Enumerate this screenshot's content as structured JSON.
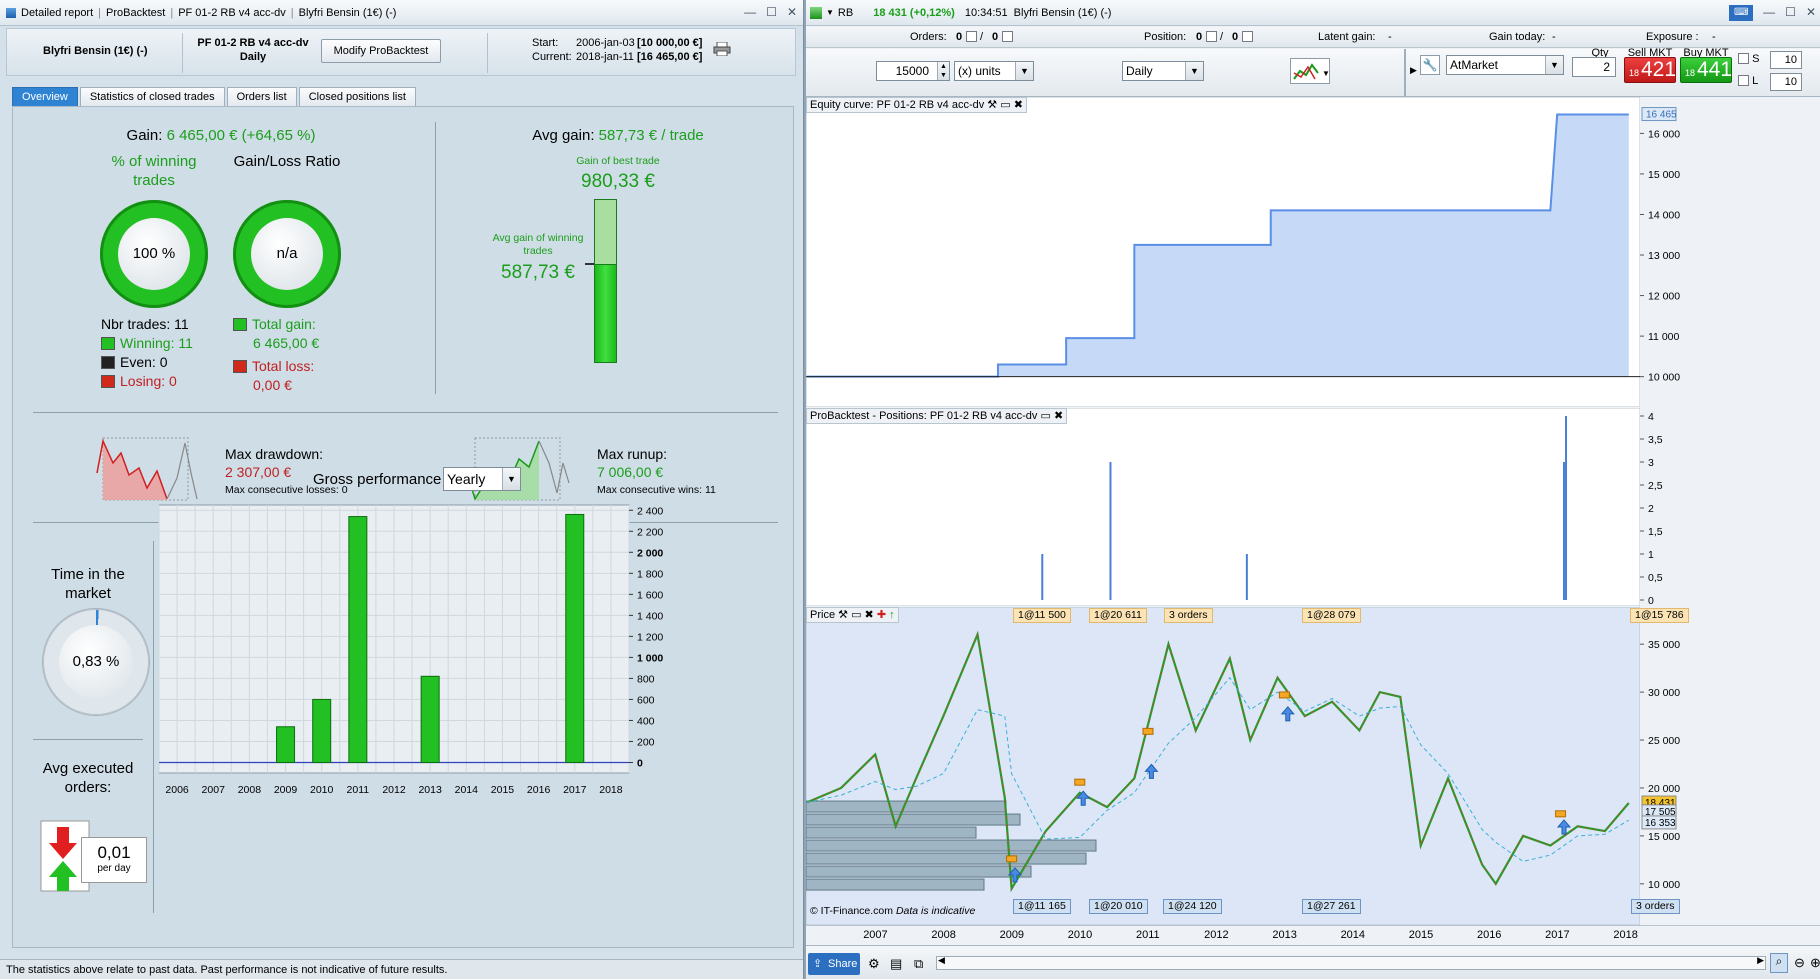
{
  "left_window": {
    "title_items": [
      "Detailed report",
      "ProBacktest",
      "PF 01-2 RB v4 acc-dv",
      "Blyfri Bensin (1€) (-)"
    ],
    "instrument": "Blyfri Bensin (1€) (-)",
    "system_name": "PF 01-2 RB v4 acc-dv",
    "timeframe": "Daily",
    "modify_button": "Modify ProBacktest",
    "start_label": "Start:",
    "start_date": "2006-jan-03",
    "start_value": "[10 000,00 €]",
    "current_label": "Current:",
    "current_date": "2018-jan-11",
    "current_value": "[16 465,00 €]",
    "tabs": [
      "Overview",
      "Statistics of closed trades",
      "Orders list",
      "Closed positions list"
    ],
    "gain_label": "Gain:",
    "gain_value": "6 465,00 € (+64,65 %)",
    "pct_winning_label": "% of winning trades",
    "gain_loss_label": "Gain/Loss Ratio",
    "pct_winning_value": "100 %",
    "pct_winning_fraction": 1.0,
    "gain_loss_value": "n/a",
    "nbr_trades": "Nbr trades: 11",
    "winning": "Winning: 11",
    "even": "Even: 0",
    "losing": "Losing: 0",
    "total_gain_label": "Total gain:",
    "total_gain_value": "6 465,00 €",
    "total_loss_label": "Total loss:",
    "total_loss_value": "0,00 €",
    "avg_gain_label": "Avg gain:",
    "avg_gain_value": "587,73 € / trade",
    "best_trade_label": "Gain of best trade",
    "best_trade_value": "980,33 €",
    "avg_win_label": "Avg gain of winning trades",
    "avg_win_value": "587,73 €",
    "max_drawdown_label": "Max drawdown:",
    "max_drawdown_value": "2 307,00 €",
    "max_consec_losses": "Max consecutive losses: 0",
    "max_runup_label": "Max runup:",
    "max_runup_value": "7 006,00 €",
    "max_consec_wins": "Max consecutive wins: 11",
    "time_in_market_label": "Time in the market",
    "time_in_market_value": "0,83 %",
    "time_in_market_fraction": 0.0083,
    "avg_orders_label": "Avg executed orders:",
    "avg_orders_value": "0,01",
    "avg_orders_unit": "per day",
    "gross_perf_label": "Gross performance",
    "gross_perf_period": "Yearly",
    "status_text": "The statistics above relate to past data. Past performance is not indicative of future results.",
    "colors": {
      "win": "#22c022",
      "loss": "#d02a1a",
      "even": "#222222",
      "accent": "#2f83d3"
    }
  },
  "chart_data": [
    {
      "type": "bar",
      "categories": [
        "2006",
        "2007",
        "2008",
        "2009",
        "2010",
        "2011",
        "2012",
        "2013",
        "2014",
        "2015",
        "2016",
        "2017",
        "2018"
      ],
      "values": [
        0,
        0,
        0,
        340,
        600,
        2340,
        0,
        820,
        0,
        0,
        0,
        2360,
        0
      ],
      "ylim": [
        -100,
        2450
      ],
      "yticks": [
        "0",
        "200",
        "400",
        "600",
        "800",
        "1 000",
        "1 200",
        "1 400",
        "1 600",
        "1 800",
        "2 000",
        "2 200",
        "2 400"
      ],
      "ytick_values": [
        0,
        200,
        400,
        600,
        800,
        1000,
        1200,
        1400,
        1600,
        1800,
        2000,
        2200,
        2400
      ],
      "grid": true
    },
    {
      "type": "area",
      "title": "Equity curve: PF 01-2 RB v4 acc-dv",
      "x": [
        2006.0,
        2008.8,
        2008.8,
        2009.8,
        2009.8,
        2010.8,
        2010.8,
        2012.8,
        2012.8,
        2016.9,
        2016.9,
        2017.0,
        2017.0,
        2018.05
      ],
      "values": [
        10000,
        10000,
        10300,
        10300,
        10950,
        10950,
        13250,
        13250,
        14100,
        14100,
        14100,
        16465,
        16465,
        16465
      ],
      "ylim": [
        9400,
        16700
      ],
      "yticks": [
        "10 000",
        "11 000",
        "12 000",
        "13 000",
        "14 000",
        "15 000",
        "16 000"
      ],
      "ytick_values": [
        10000,
        11000,
        12000,
        13000,
        14000,
        15000,
        16000
      ],
      "last_value": "16 465"
    },
    {
      "type": "bar",
      "title": "ProBacktest - Positions: PF 01-2 RB v4 acc-dv",
      "x": [
        2009.45,
        2010.45,
        2012.45,
        2017.1,
        2017.13
      ],
      "values": [
        1,
        3,
        1,
        3,
        4
      ],
      "ylim": [
        0,
        4
      ],
      "yticks": [
        "0",
        "0,5",
        "1",
        "1,5",
        "2",
        "2,5",
        "3",
        "3,5",
        "4"
      ],
      "ytick_values": [
        0,
        0.5,
        1,
        1.5,
        2,
        2.5,
        3,
        3.5,
        4
      ]
    },
    {
      "type": "line",
      "title": "Price",
      "x": [
        2006.0,
        2006.5,
        2007.0,
        2007.3,
        2007.6,
        2008.0,
        2008.5,
        2008.9,
        2009.0,
        2009.5,
        2010.0,
        2010.4,
        2010.8,
        2011.3,
        2011.7,
        2012.2,
        2012.5,
        2012.9,
        2013.3,
        2013.7,
        2014.1,
        2014.4,
        2014.7,
        2015.0,
        2015.4,
        2015.9,
        2016.1,
        2016.5,
        2016.9,
        2017.3,
        2017.7,
        2018.05
      ],
      "values": [
        18500,
        20000,
        23500,
        16000,
        21000,
        27500,
        36000,
        19000,
        9500,
        15500,
        19500,
        18000,
        21000,
        35000,
        26000,
        33500,
        25000,
        31500,
        27500,
        29000,
        26000,
        30000,
        29500,
        14000,
        21000,
        12000,
        10000,
        15000,
        14000,
        16000,
        15500,
        18431
      ],
      "ylim": [
        8000,
        37000
      ],
      "yticks": [
        "10 000",
        "15 000",
        "20 000",
        "25 000",
        "30 000",
        "35 000"
      ],
      "ytick_values": [
        10000,
        15000,
        20000,
        25000,
        30000,
        35000
      ],
      "price_labels": [
        "18 431",
        "17 505",
        "16 353"
      ]
    }
  ],
  "right_window": {
    "symbol": "RB",
    "price": "18 431 (+0,12%)",
    "time": "10:34:51",
    "instrument": "Blyfri Bensin (1€) (-)",
    "orders_label": "Orders:",
    "orders_a": "0",
    "orders_b": "0",
    "position_label": "Position:",
    "position_a": "0",
    "position_b": "0",
    "latent_label": "Latent gain:",
    "latent_value": "-",
    "gain_today_label": "Gain today:",
    "gain_today_value": "-",
    "exposure_label": "Exposure :",
    "exposure_value": "-",
    "units_value": "15000",
    "units_select": "(x) units",
    "timeframe_select": "Daily",
    "order_type": "AtMarket",
    "qty_label": "Qty",
    "qty_value": "2",
    "sell_label": "Sell MKT",
    "sell_small": "18",
    "sell_big": "421",
    "buy_label": "Buy MKT",
    "buy_small": "18",
    "buy_big": "441",
    "s_label": "S",
    "s_value": "10",
    "l_label": "L",
    "l_value": "10",
    "top_tags": [
      "1@11 500",
      "1@20 611",
      "3 orders",
      "1@28 079",
      "1@15 786"
    ],
    "bottom_tags": [
      "1@11 165",
      "1@20 010",
      "1@24 120",
      "1@27 261",
      "3 orders"
    ],
    "copyright": "© IT-Finance.com",
    "data_note": "Data is indicative",
    "xaxis_years": [
      "2007",
      "2008",
      "2009",
      "2010",
      "2011",
      "2012",
      "2013",
      "2014",
      "2015",
      "2016",
      "2017",
      "2018"
    ],
    "share_label": "Share"
  }
}
